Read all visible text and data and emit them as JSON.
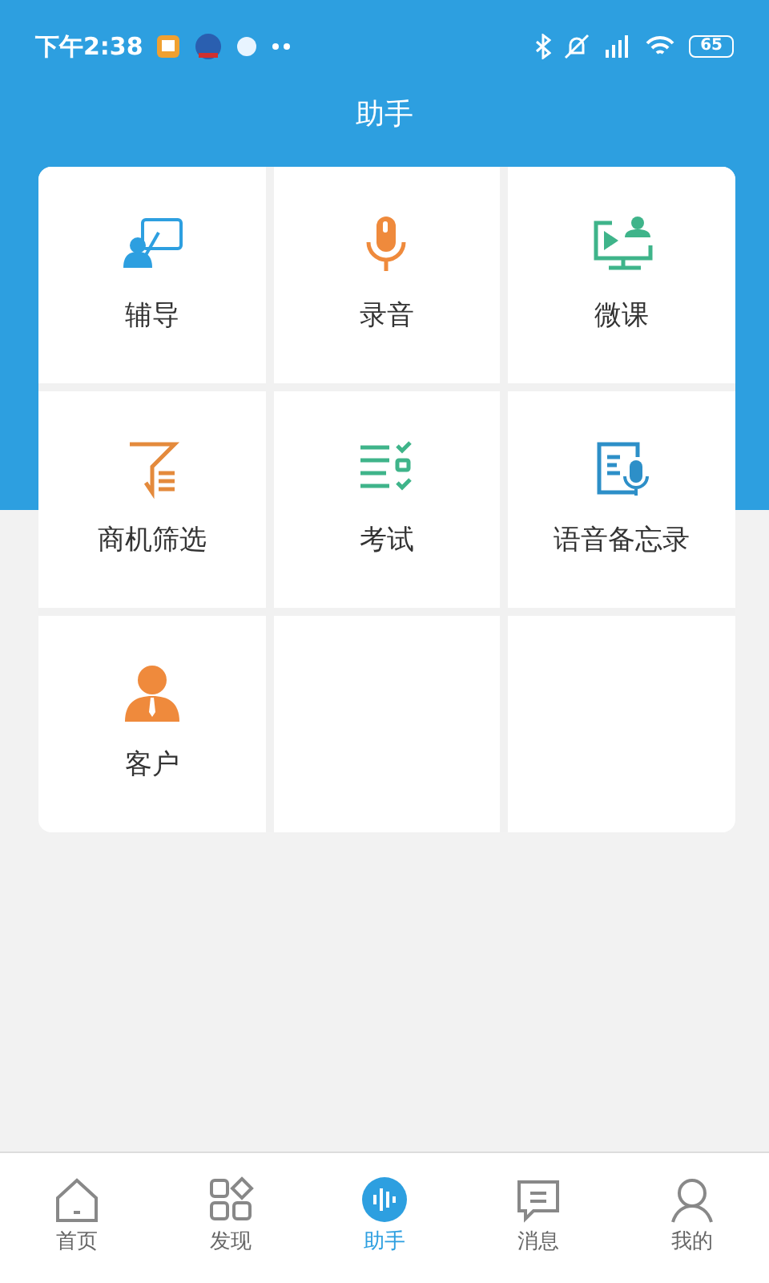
{
  "status_bar": {
    "time": "下午2:38",
    "battery": "65"
  },
  "header": {
    "title": "助手"
  },
  "tools": [
    {
      "label": "辅导"
    },
    {
      "label": "录音"
    },
    {
      "label": "微课"
    },
    {
      "label": "商机筛选"
    },
    {
      "label": "考试"
    },
    {
      "label": "语音备忘录"
    },
    {
      "label": "客户"
    }
  ],
  "tabs": [
    {
      "label": "首页",
      "selected": false
    },
    {
      "label": "发现",
      "selected": false
    },
    {
      "label": "助手",
      "selected": true
    },
    {
      "label": "消息",
      "selected": false
    },
    {
      "label": "我的",
      "selected": false
    }
  ]
}
